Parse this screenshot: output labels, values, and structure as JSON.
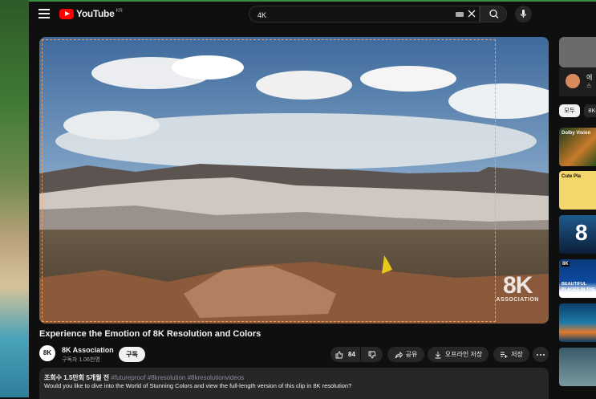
{
  "header": {
    "logo_text": "YouTube",
    "logo_region": "KR",
    "search_value": "4K"
  },
  "video": {
    "title": "Experience the Emotion of 8K Resolution and Colors",
    "overlay_brand": "8K",
    "overlay_brand_sub": "ASSOCIATION"
  },
  "channel": {
    "avatar_text": "8K",
    "name": "8K Association",
    "subscribers": "구독자 1.06천명",
    "subscribe_label": "구독"
  },
  "actions": {
    "likes": "84",
    "share": "공유",
    "offline": "오프라인 저장",
    "save": "저장"
  },
  "description": {
    "views": "조회수 1.5만회",
    "age": "5개월 전",
    "tags": "#futureproof #8kresolution #8kresolutionvideos",
    "text": "Would you like to dive into the World of Stunning Colors and view the full-length version of this clip in 8K resolution?"
  },
  "sidebar": {
    "channel_title": "에",
    "channel_sub": "스",
    "chips": [
      "모두",
      "8K"
    ],
    "thumbs": [
      {
        "label": "Dolby Vision"
      },
      {
        "label": "Cute Pla"
      },
      {
        "label": "8"
      },
      {
        "badge": "8K",
        "caption": "BEAUTIFUL PLACES IN THE WORLD"
      },
      {
        "label": ""
      },
      {
        "label": ""
      }
    ]
  },
  "colors": {
    "accent_red": "#ff0000",
    "background": "#0f0f0f",
    "chip_bg": "#272727"
  }
}
